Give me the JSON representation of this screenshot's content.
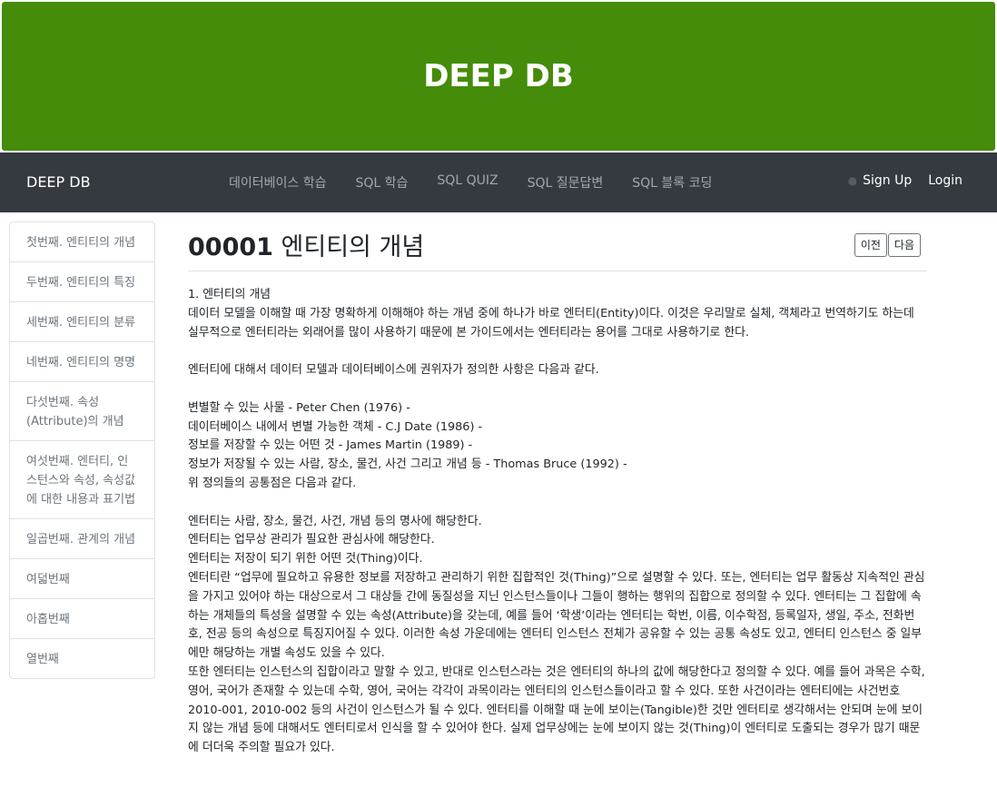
{
  "banner": {
    "title": "DEEP DB"
  },
  "navbar": {
    "brand": "DEEP DB",
    "links": [
      "데이터베이스 학습",
      "SQL 학습",
      "SQL QUIZ",
      "SQL 질문답변",
      "SQL 블록 코딩"
    ],
    "signup": "Sign Up",
    "login": "Login"
  },
  "sidebar": {
    "items": [
      "첫번째. 엔티티의 개념",
      "두번째. 엔티티의 특징",
      "세번째. 엔티티의 분류",
      "네번째. 엔티티의 명명",
      "다섯번째. 속성(Attribute)의 개념",
      "여섯번째. 엔터티, 인스턴스와 속성, 속성값에 대한 내용과 표기법",
      "일곱번째. 관계의 개념",
      "여덟번째",
      "아홉번째",
      "열번째"
    ]
  },
  "main": {
    "title_num": "00001",
    "title_text": "엔티티의 개념",
    "prev": "이전",
    "next": "다음",
    "paragraphs": [
      "1. 엔터티의 개념",
      "데이터 모델을 이해할 때 가장 명확하게 이해해야 하는 개념 중에 하나가 바로 엔터티(Entity)이다. 이것은 우리말로 실체, 객체라고 번역하기도 하는데 실무적으로 엔터티라는 외래어를 많이 사용하기 때문에 본 가이드에서는 엔터티라는 용어를 그대로 사용하기로 한다.",
      "",
      "엔터티에 대해서 데이터 모델과 데이터베이스에 권위자가 정의한 사항은 다음과 같다.",
      "",
      "변별할 수 있는 사물 - Peter Chen (1976) -",
      "데이터베이스 내에서 변별 가능한 객체 - C.J Date (1986) -",
      "정보를 저장할 수 있는 어떤 것 - James Martin (1989) -",
      "정보가 저장될 수 있는 사람, 장소, 물건, 사건 그리고 개념 등 - Thomas Bruce (1992) -",
      "위 정의들의 공통점은 다음과 같다.",
      "",
      "엔터티는 사람, 장소, 물건, 사건, 개념 등의 명사에 해당한다.",
      "엔터티는 업무상 관리가 필요한 관심사에 해당한다.",
      "엔터티는 저장이 되기 위한 어떤 것(Thing)이다.",
      "엔터티란 “업무에 필요하고 유용한 정보를 저장하고 관리하기 위한 집합적인 것(Thing)”으로 설명할 수 있다. 또는, 엔터티는 업무 활동상 지속적인 관심을 가지고 있어야 하는 대상으로서 그 대상들 간에 동질성을 지닌 인스턴스들이나 그들이 행하는 행위의 집합으로 정의할 수 있다. 엔터티는 그 집합에 속하는 개체들의 특성을 설명할 수 있는 속성(Attribute)을 갖는데, 예를 들어 ‘학생’이라는 엔터티는 학번, 이름, 이수학점, 등록일자, 생일, 주소, 전화번호, 전공 등의 속성으로 특징지어질 수 있다. 이러한 속성 가운데에는 엔터티 인스턴스 전체가 공유할 수 있는 공통 속성도 있고, 엔터티 인스턴스 중 일부에만 해당하는 개별 속성도 있을 수 있다.",
      "또한 엔터티는 인스턴스의 집합이라고 말할 수 있고, 반대로 인스턴스라는 것은 엔터티의 하나의 값에 해당한다고 정의할 수 있다. 예를 들어 과목은 수학, 영어, 국어가 존재할 수 있는데 수학, 영어, 국어는 각각이 과목이라는 엔터티의 인스턴스들이라고 할 수 있다. 또한 사건이라는 엔터티에는 사건번호2010-001, 2010-002 등의 사건이 인스턴스가 될 수 있다. 엔터티를 이해할 때 눈에 보이는(Tangible)한 것만 엔터티로 생각해서는 안되며 눈에 보이지 않는 개념 등에 대해서도 엔터티로서 인식을 할 수 있어야 한다. 실제 업무상에는 눈에 보이지 않는 것(Thing)이 엔터티로 도출되는 경우가 많기 때문에 더더욱 주의할 필요가 있다."
    ]
  }
}
